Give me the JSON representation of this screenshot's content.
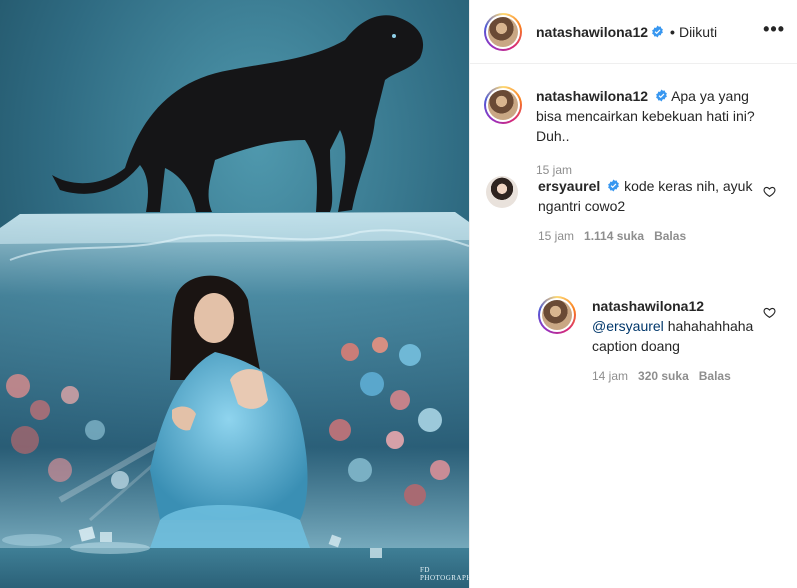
{
  "photo": {
    "alt": "",
    "watermark": "FD PHOTOGRAPHY"
  },
  "header": {
    "username": "natashawilona12",
    "separator": "•",
    "follow_status": "Diikuti",
    "more_icon": "more-horizontal-icon"
  },
  "caption": {
    "username": "natashawilona12",
    "text": "Apa ya yang bisa mencairkan kebekuan hati ini? Duh..",
    "time": "15 jam"
  },
  "comments": [
    {
      "username": "ersyaurel",
      "text": "kode keras nih, ayuk ngantri cowo2",
      "time": "15 jam",
      "likes": "1.114 suka",
      "reply": "Balas"
    },
    {
      "username": "natashawilona12",
      "mention": "@ersyaurel",
      "text": "hahahahhaha caption doang",
      "time": "14 jam",
      "likes": "320 suka",
      "reply": "Balas"
    }
  ],
  "colors": {
    "verified": "#3897f0",
    "muted": "#8e8e8e",
    "text": "#262626",
    "mention": "#00376b"
  }
}
